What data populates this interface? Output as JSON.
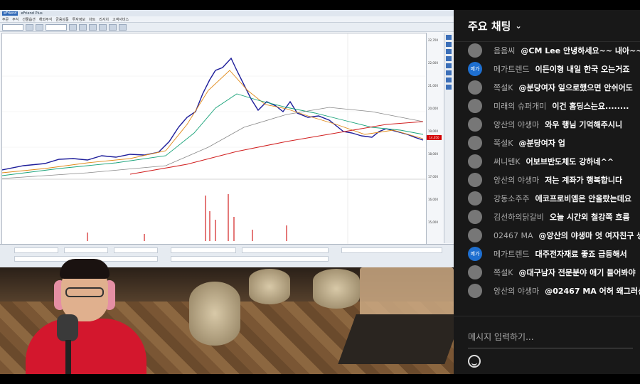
{
  "hts": {
    "title_logo": "eFriend",
    "title_text": "eFriend Plus",
    "menu": [
      "주문",
      "주식",
      "선물옵션",
      "해외주식",
      "금융상품",
      "투자정보",
      "차트",
      "리서치",
      "고객서비스"
    ],
    "price_ticks": [
      "22,700",
      "22,000",
      "21,000",
      "20,000",
      "19,000",
      "18,000",
      "17,000",
      "16,000",
      "15,000"
    ],
    "current_price": "14,050"
  },
  "chat": {
    "header": "주요 채팅",
    "messages": [
      {
        "author": "음음씨",
        "text": "@CM Lee 안녕하세요~~ 내아~~",
        "avatar": "photo",
        "avatar_label": ""
      },
      {
        "author": "메가트렌드",
        "text": "이든이형 내일 한국 오는거죠",
        "avatar": "blue",
        "avatar_label": "메가"
      },
      {
        "author": "쪽설K",
        "text": "@분당여자 잎으로했으면 안쉬어도",
        "avatar": "photo",
        "avatar_label": ""
      },
      {
        "author": "미래의 슈퍼개미",
        "text": "이건 홈딩스는요........",
        "avatar": "photo",
        "avatar_label": ""
      },
      {
        "author": "앙산의 야생마",
        "text": "와우 행님 기억해주시니",
        "avatar": "photo",
        "avatar_label": ""
      },
      {
        "author": "쪽설K",
        "text": "@분당여자 업",
        "avatar": "photo",
        "avatar_label": ""
      },
      {
        "author": "써니텐K",
        "text": "어보브반도체도 강하네^^",
        "avatar": "photo",
        "avatar_label": ""
      },
      {
        "author": "앙산의 야생마",
        "text": "저는 계좌가 행복합니다",
        "avatar": "photo",
        "avatar_label": ""
      },
      {
        "author": "강동소주주",
        "text": "에코프로비엠은 안올랐는데요",
        "avatar": "photo",
        "avatar_label": ""
      },
      {
        "author": "김선하의닭갈비",
        "text": "오늘 시간외 철강쪽 흐름",
        "avatar": "photo",
        "avatar_label": ""
      },
      {
        "author": "02467 MA",
        "text": "@앙산의 야생마 엇 여자친구 생",
        "avatar": "photo",
        "avatar_label": ""
      },
      {
        "author": "메가트렌드",
        "text": "대주전자재료 좋죠 급등해서",
        "avatar": "blue",
        "avatar_label": "메가"
      },
      {
        "author": "쪽설K",
        "text": "@대구남자 전문분야 애기 들어봐야",
        "avatar": "photo",
        "avatar_label": ""
      },
      {
        "author": "앙산의 야생마",
        "text": "@02467 MA 어허 왜그러신",
        "avatar": "photo",
        "avatar_label": ""
      }
    ],
    "input_placeholder": "메시지 입력하기..."
  }
}
